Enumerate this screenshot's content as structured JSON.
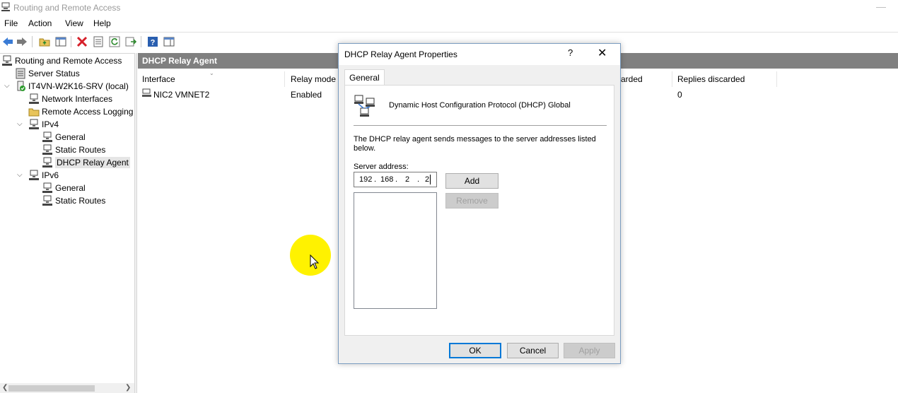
{
  "window": {
    "title": "Routing and Remote Access"
  },
  "menu": {
    "file": "File",
    "action": "Action",
    "view": "View",
    "help": "Help"
  },
  "tree": {
    "root": "Routing and Remote Access",
    "server_status": "Server Status",
    "server": "IT4VN-W2K16-SRV (local)",
    "network_interfaces": "Network Interfaces",
    "remote_access_logging": "Remote Access Logging",
    "ipv4": "IPv4",
    "ipv4_general": "General",
    "ipv4_static_routes": "Static Routes",
    "ipv4_dhcp_relay": "DHCP Relay Agent",
    "ipv6": "IPv6",
    "ipv6_general": "General",
    "ipv6_static_routes": "Static Routes"
  },
  "details": {
    "header": "DHCP Relay Agent",
    "columns": {
      "interface": "Interface",
      "relay_mode": "Relay mode",
      "requests_discarded": "arded",
      "replies_discarded": "Replies discarded"
    },
    "rows": [
      {
        "interface": "NIC2 VMNET2",
        "relay_mode": "Enabled",
        "replies_discarded": "0"
      }
    ]
  },
  "dialog": {
    "title": "DHCP Relay Agent Properties",
    "help": "?",
    "close": "✕",
    "tab": "General",
    "heading": "Dynamic Host Configuration Protocol (DHCP) Global",
    "description": "The DHCP relay agent sends messages to the server addresses listed below.",
    "server_address_label": "Server address:",
    "ip": {
      "o1": "192",
      "o2": "168",
      "o3": "2",
      "o4": "2"
    },
    "add": "Add",
    "remove": "Remove",
    "ok": "OK",
    "cancel": "Cancel",
    "apply": "Apply"
  }
}
